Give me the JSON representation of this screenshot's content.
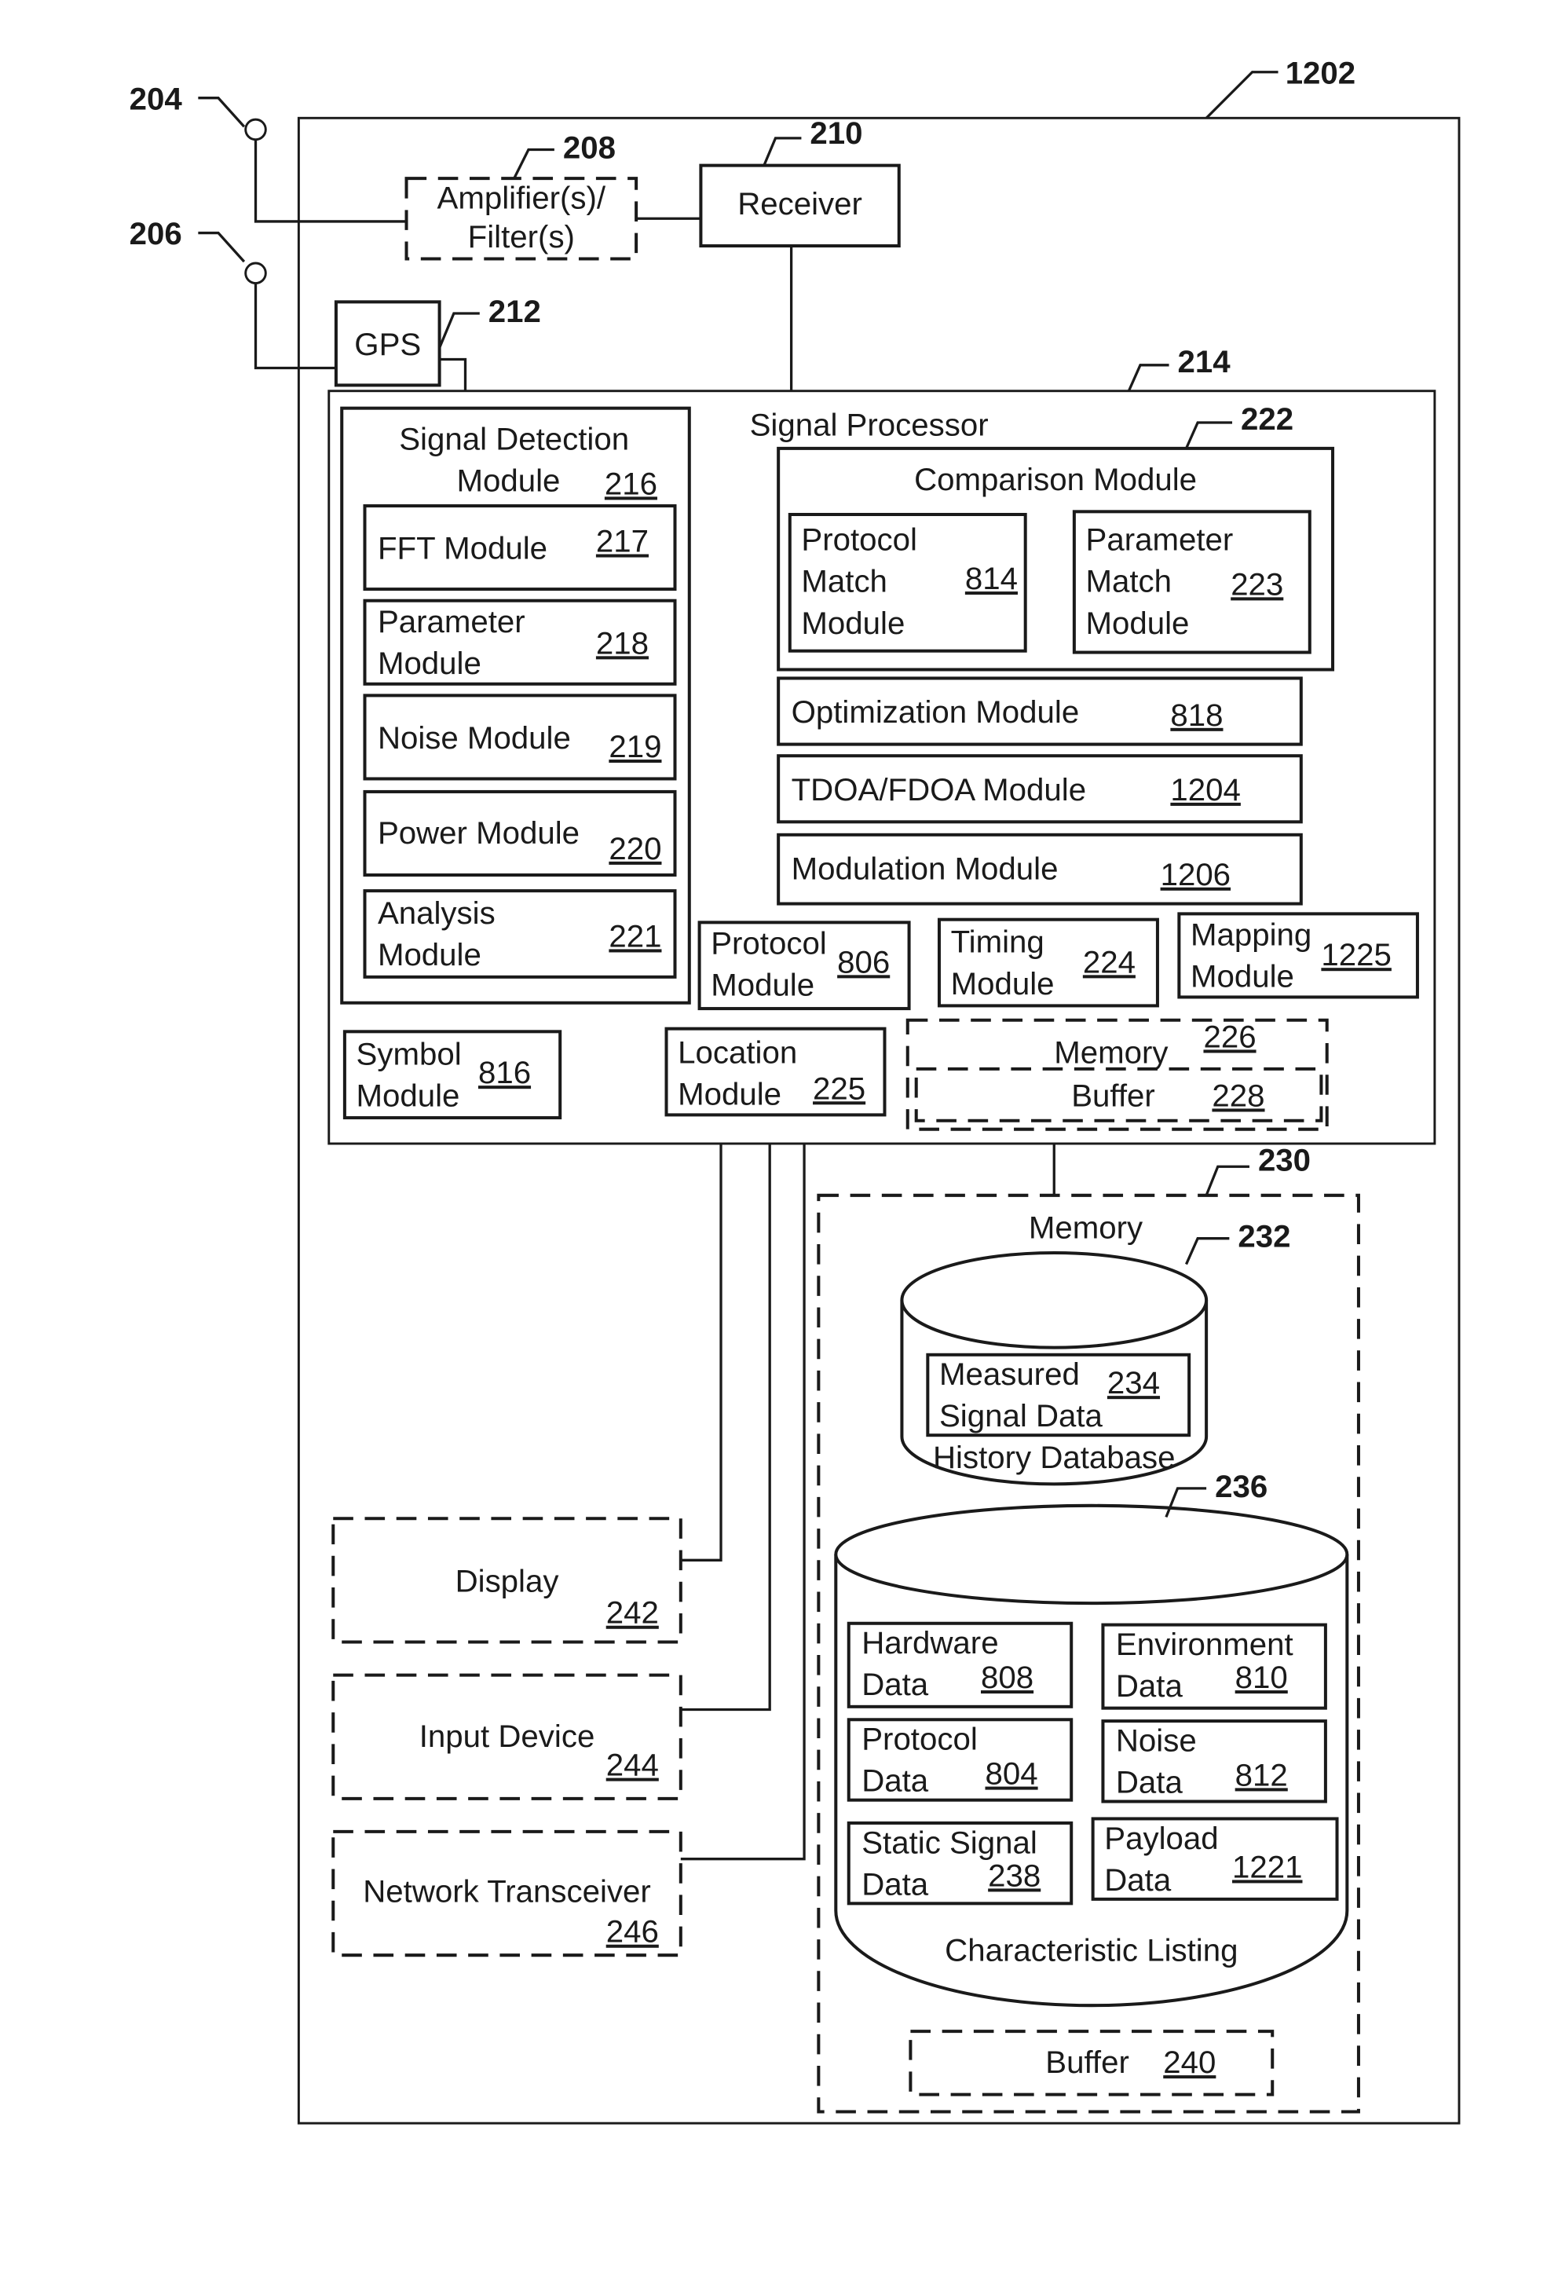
{
  "callouts": {
    "antenna1": "204",
    "antenna2": "206",
    "device": "1202",
    "amplifier": "208",
    "receiver": "210",
    "gps": "212",
    "signal_processor": "214",
    "comparison": "222",
    "memory_outer": "230",
    "history_db": "232",
    "char_listing": "236"
  },
  "blocks": {
    "amplifier": {
      "line1": "Amplifier(s)/",
      "line2": "Filter(s)"
    },
    "receiver": {
      "label": "Receiver"
    },
    "gps": {
      "label": "GPS"
    },
    "signal_processor": {
      "label": "Signal Processor"
    },
    "signal_detection": {
      "line1": "Signal Detection",
      "line2": "Module",
      "ref": "216"
    },
    "fft": {
      "label": "FFT Module",
      "ref": "217"
    },
    "parameter": {
      "line1": "Parameter",
      "line2": "Module",
      "ref": "218"
    },
    "noise": {
      "label": "Noise Module",
      "ref": "219"
    },
    "power": {
      "label": "Power Module",
      "ref": "220"
    },
    "analysis": {
      "line1": "Analysis",
      "line2": "Module",
      "ref": "221"
    },
    "comparison": {
      "label": "Comparison Module"
    },
    "protocol_match": {
      "line1": "Protocol",
      "line2": "Match",
      "line3": "Module",
      "ref": "814"
    },
    "parameter_match": {
      "line1": "Parameter",
      "line2": "Match",
      "line3": "Module",
      "ref": "223"
    },
    "optimization": {
      "label": "Optimization Module",
      "ref": "818"
    },
    "tdoa": {
      "label": "TDOA/FDOA Module",
      "ref": "1204"
    },
    "modulation": {
      "label": "Modulation Module",
      "ref": "1206"
    },
    "protocol": {
      "line1": "Protocol",
      "line2": "Module",
      "ref": "806"
    },
    "timing": {
      "line1": "Timing",
      "line2": "Module",
      "ref": "224"
    },
    "mapping": {
      "line1": "Mapping",
      "line2": "Module",
      "ref": "1225"
    },
    "symbol": {
      "line1": "Symbol",
      "line2": "Module",
      "ref": "816"
    },
    "location": {
      "line1": "Location",
      "line2": "Module",
      "ref": "225"
    },
    "memory_inner": {
      "label": "Memory",
      "ref": "226"
    },
    "buffer_inner": {
      "label": "Buffer",
      "ref": "228"
    },
    "memory_outer": {
      "label": "Memory"
    },
    "history_db": {
      "label": "History Database"
    },
    "measured": {
      "line1": "Measured",
      "line2": "Signal Data",
      "ref": "234"
    },
    "hardware": {
      "line1": "Hardware",
      "line2": "Data",
      "ref": "808"
    },
    "environment": {
      "line1": "Environment",
      "line2": "Data",
      "ref": "810"
    },
    "protocol_data": {
      "line1": "Protocol",
      "line2": "Data",
      "ref": "804"
    },
    "noise_data": {
      "line1": "Noise",
      "line2": "Data",
      "ref": "812"
    },
    "static_signal": {
      "line1": "Static Signal",
      "line2": "Data",
      "ref": "238"
    },
    "payload": {
      "line1": "Payload",
      "line2": "Data",
      "ref": "1221"
    },
    "char_listing": {
      "label": "Characteristic Listing"
    },
    "buffer_outer": {
      "label": "Buffer",
      "ref": "240"
    },
    "display": {
      "label": "Display",
      "ref": "242"
    },
    "input_device": {
      "label": "Input Device",
      "ref": "244"
    },
    "network": {
      "label": "Network Transceiver",
      "ref": "246"
    }
  }
}
